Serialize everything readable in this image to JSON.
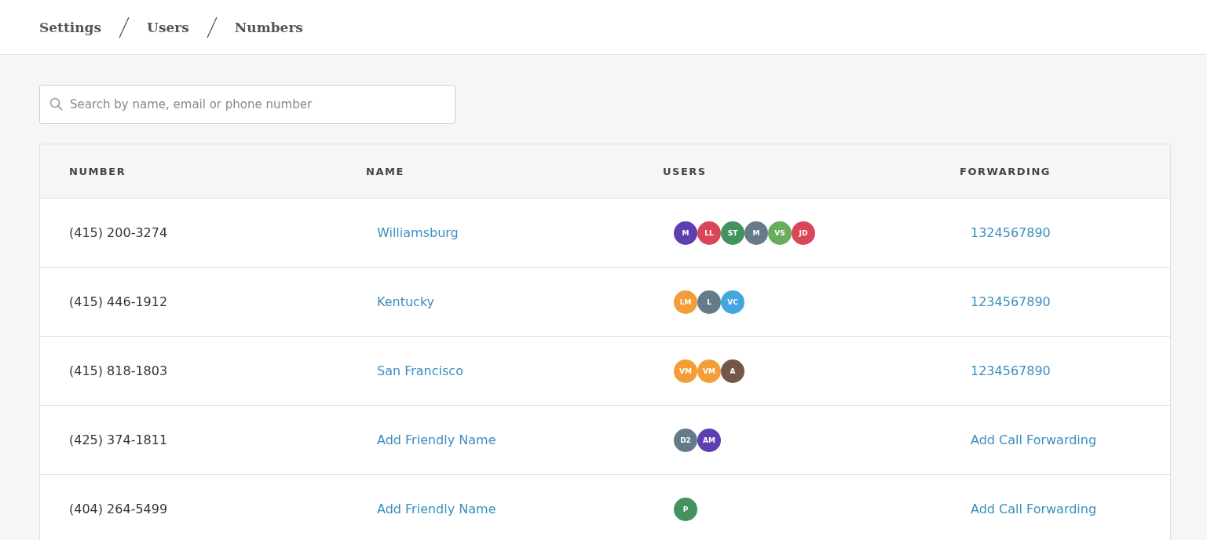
{
  "breadcrumb": [
    "Settings",
    "Users",
    "Numbers"
  ],
  "search": {
    "placeholder": "Search by name, email or phone number"
  },
  "table": {
    "columns": [
      "NUMBER",
      "NAME",
      "USERS",
      "FORWARDING"
    ],
    "rows": [
      {
        "number": "(415) 200-3274",
        "name": "Williamsburg",
        "users": [
          {
            "initials": "M",
            "color": "#5e3fb0"
          },
          {
            "initials": "LL",
            "color": "#d8465a"
          },
          {
            "initials": "ST",
            "color": "#44925e"
          },
          {
            "initials": "M",
            "color": "#657b89"
          },
          {
            "initials": "VS",
            "color": "#67ad5b"
          },
          {
            "initials": "JD",
            "color": "#d8465a"
          }
        ],
        "forwarding": "1324567890"
      },
      {
        "number": "(415) 446-1912",
        "name": "Kentucky",
        "users": [
          {
            "initials": "LM",
            "color": "#f29d38"
          },
          {
            "initials": "L",
            "color": "#657b89"
          },
          {
            "initials": "VC",
            "color": "#44a6df"
          }
        ],
        "forwarding": "1234567890"
      },
      {
        "number": "(415) 818-1803",
        "name": "San Francisco",
        "users": [
          {
            "initials": "VM",
            "color": "#f29d38"
          },
          {
            "initials": "VM",
            "color": "#f29d38"
          },
          {
            "initials": "A",
            "color": "#74564a"
          }
        ],
        "forwarding": "1234567890"
      },
      {
        "number": "(425) 374-1811",
        "name": "Add Friendly Name",
        "users": [
          {
            "initials": "D2",
            "color": "#657b89"
          },
          {
            "initials": "AM",
            "color": "#5e3fb0"
          }
        ],
        "forwarding": "Add Call Forwarding"
      },
      {
        "number": "(404) 264-5499",
        "name": "Add Friendly Name",
        "users": [
          {
            "initials": "P",
            "color": "#44925e"
          }
        ],
        "forwarding": "Add Call Forwarding"
      }
    ]
  }
}
